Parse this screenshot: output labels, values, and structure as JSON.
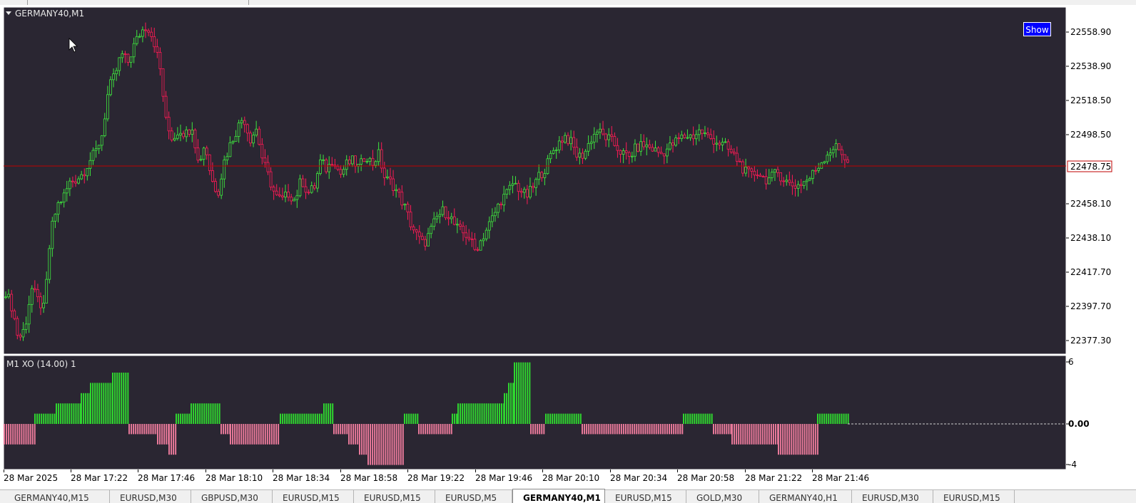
{
  "main_chart": {
    "symbol_label": "GERMANY40,M1",
    "show_button": "Show",
    "current_price": "22478.75",
    "price_ticks": [
      "22558.90",
      "22538.90",
      "22518.50",
      "22498.50",
      "22458.10",
      "22438.10",
      "22417.70",
      "22397.70",
      "22377.30"
    ]
  },
  "indicator": {
    "label": "M1 XO (14.00) 1",
    "ticks": [
      "6",
      "0.00",
      "-4"
    ]
  },
  "time_axis": [
    "28 Mar 2025",
    "28 Mar 17:22",
    "28 Mar 17:46",
    "28 Mar 18:10",
    "28 Mar 18:34",
    "28 Mar 18:58",
    "28 Mar 19:22",
    "28 Mar 19:46",
    "28 Mar 20:10",
    "28 Mar 20:34",
    "28 Mar 20:58",
    "28 Mar 21:22",
    "28 Mar 21:46"
  ],
  "tabs": [
    "GERMANY40,M15",
    "EURUSD,M30",
    "GBPUSD,M30",
    "EURUSD,M15",
    "EURUSD,M15",
    "EURUSD,M5",
    "GERMANY40,M1",
    "EURUSD,M15",
    "GOLD,M30",
    "GERMANY40,H1",
    "EURUSD,M30",
    "EURUSD,M15"
  ],
  "active_tab": 6,
  "colors": {
    "background": "#2a2632",
    "bull": "#3ee63e",
    "bear": "#ff1a55",
    "hist_up": "#2fd52f",
    "hist_down": "#e8799a",
    "price_line": "#c00000"
  },
  "chart_data": {
    "type": "candlestick",
    "price_ylim": [
      22372,
      22566
    ],
    "indicator_ylim": [
      -4,
      6
    ],
    "candle_closes": [
      22407,
      22398,
      22380,
      22387,
      22409,
      22402,
      22397,
      22440,
      22455,
      22460,
      22468,
      22470,
      22473,
      22480,
      22485,
      22495,
      22520,
      22528,
      22540,
      22535,
      22545,
      22552,
      22556,
      22548,
      22532,
      22500,
      22492,
      22498,
      22495,
      22500,
      22478,
      22490,
      22470,
      22462,
      22480,
      22490,
      22498,
      22505,
      22492,
      22498,
      22480,
      22470,
      22460,
      22458,
      22462,
      22458,
      22470,
      22462,
      22465,
      22480,
      22475,
      22482,
      22472,
      22478,
      22480,
      22476,
      22484,
      22478,
      22484,
      22470,
      22468,
      22462,
      22455,
      22445,
      22438,
      22433,
      22440,
      22448,
      22452,
      22450,
      22443,
      22440,
      22438,
      22430,
      22436,
      22443,
      22450,
      22458,
      22462,
      22468,
      22464,
      22460,
      22465,
      22472,
      22476,
      22485,
      22490,
      22494,
      22490,
      22482,
      22484,
      22492,
      22497,
      22494,
      22492,
      22488,
      22484,
      22482,
      22487,
      22489,
      22488,
      22486,
      22484,
      22487,
      22490,
      22493,
      22494,
      22494,
      22497,
      22494,
      22492,
      22490,
      22488,
      22484,
      22480,
      22474,
      22472,
      22474,
      22470,
      22470,
      22474,
      22470,
      22467,
      22466,
      22468,
      22470,
      22475,
      22480,
      22485,
      22488,
      22485,
      22480
    ]
  }
}
